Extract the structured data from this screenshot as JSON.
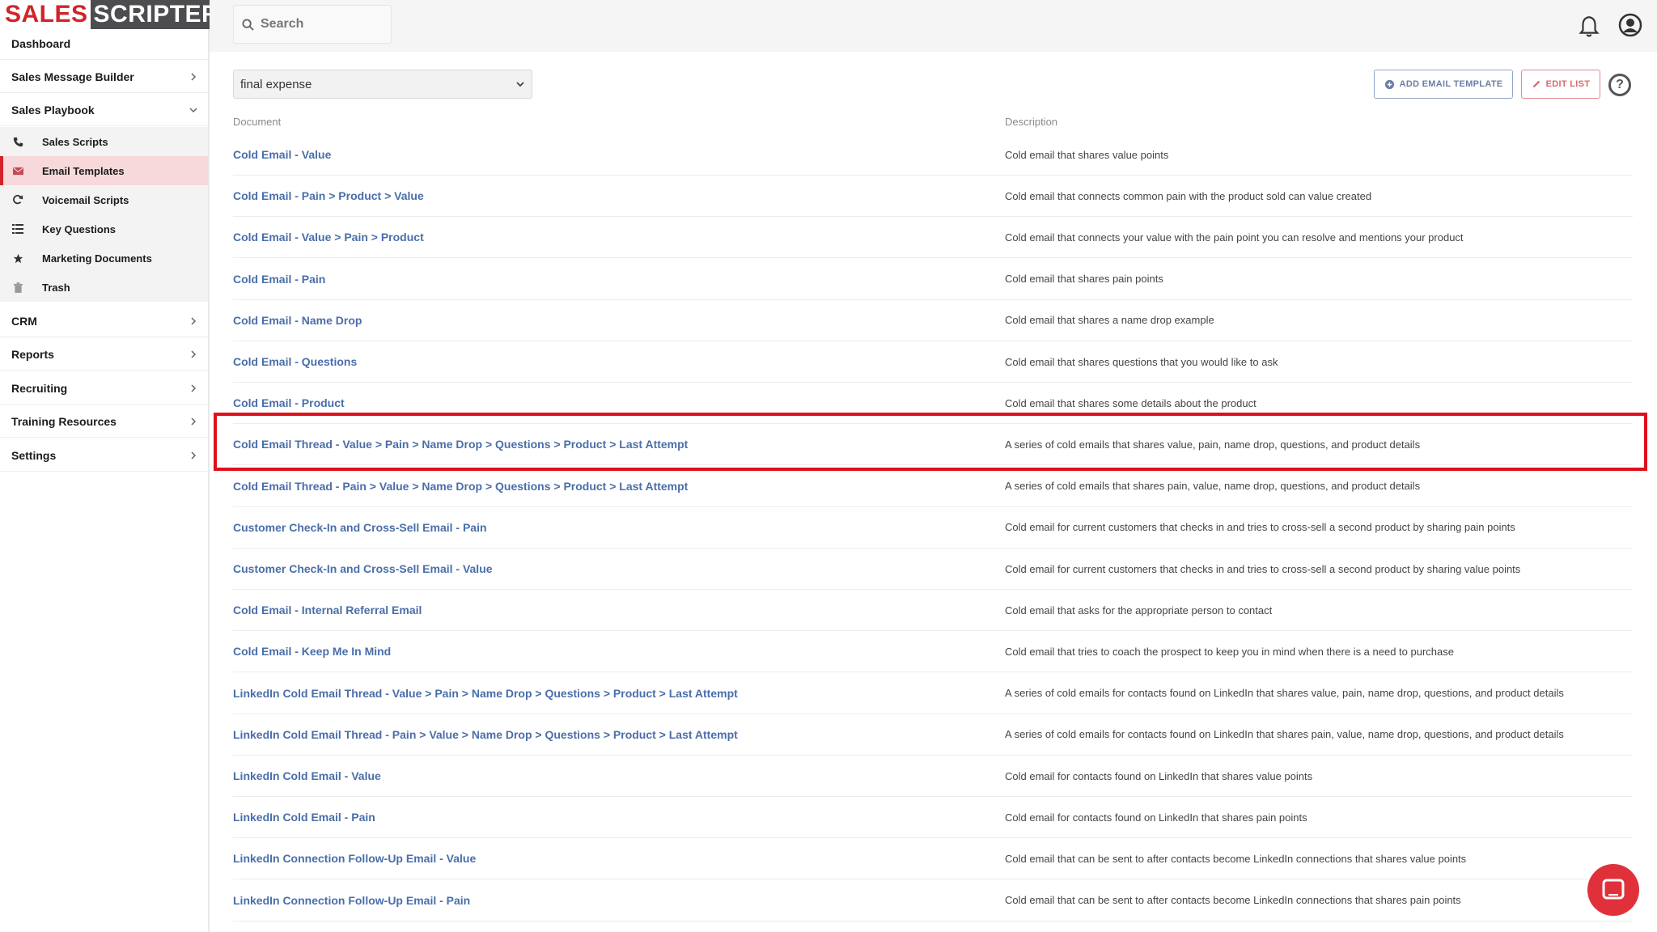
{
  "app": {
    "logo_left": "SALES",
    "logo_right": "SCRIPTER"
  },
  "search": {
    "placeholder": "Search"
  },
  "sidebar": {
    "dashboard": "Dashboard",
    "sales_message_builder": "Sales Message Builder",
    "sales_playbook": "Sales Playbook",
    "sub_items": [
      {
        "label": "Sales Scripts",
        "icon": "phone-icon"
      },
      {
        "label": "Email Templates",
        "icon": "email-icon"
      },
      {
        "label": "Voicemail Scripts",
        "icon": "voicemail-icon"
      },
      {
        "label": "Key Questions",
        "icon": "list-icon"
      },
      {
        "label": "Marketing Documents",
        "icon": "star-icon"
      },
      {
        "label": "Trash",
        "icon": "trash-icon"
      }
    ],
    "crm": "CRM",
    "reports": "Reports",
    "recruiting": "Recruiting",
    "training_resources": "Training Resources",
    "settings": "Settings"
  },
  "toolbar": {
    "filter_value": "final expense",
    "add_label": "ADD EMAIL TEMPLATE",
    "edit_label": "EDIT LIST",
    "help_label": "?"
  },
  "table": {
    "headers": {
      "document": "Document",
      "description": "Description"
    },
    "rows": [
      {
        "doc": "Cold Email - Value",
        "desc": "Cold email that shares value points"
      },
      {
        "doc": "Cold Email - Pain > Product > Value",
        "desc": "Cold email that connects common pain with the product sold can value created"
      },
      {
        "doc": "Cold Email - Value > Pain > Product",
        "desc": "Cold email that connects your value with the pain point you can resolve and mentions your product"
      },
      {
        "doc": "Cold Email - Pain",
        "desc": "Cold email that shares pain points"
      },
      {
        "doc": "Cold Email - Name Drop",
        "desc": "Cold email that shares a name drop example"
      },
      {
        "doc": "Cold Email - Questions",
        "desc": "Cold email that shares questions that you would like to ask"
      },
      {
        "doc": "Cold Email - Product",
        "desc": "Cold email that shares some details about the product"
      },
      {
        "doc": "Cold Email Thread - Value > Pain > Name Drop > Questions > Product > Last Attempt",
        "desc": "A series of cold emails that shares value, pain, name drop, questions, and product details"
      },
      {
        "doc": "Cold Email Thread - Pain > Value > Name Drop > Questions > Product > Last Attempt",
        "desc": "A series of cold emails that shares pain, value, name drop, questions, and product details"
      },
      {
        "doc": "Customer Check-In and Cross-Sell Email - Pain",
        "desc": "Cold email for current customers that checks in and tries to cross-sell a second product by sharing pain points"
      },
      {
        "doc": "Customer Check-In and Cross-Sell Email - Value",
        "desc": "Cold email for current customers that checks in and tries to cross-sell a second product by sharing value points"
      },
      {
        "doc": "Cold Email - Internal Referral Email",
        "desc": "Cold email that asks for the appropriate person to contact"
      },
      {
        "doc": "Cold Email - Keep Me In Mind",
        "desc": "Cold email that tries to coach the prospect to keep you in mind when there is a need to purchase"
      },
      {
        "doc": "LinkedIn Cold Email Thread - Value > Pain > Name Drop > Questions > Product > Last Attempt",
        "desc": "A series of cold emails for contacts found on LinkedIn that shares value, pain, name drop, questions, and product details"
      },
      {
        "doc": "LinkedIn Cold Email Thread - Pain > Value > Name Drop > Questions > Product > Last Attempt",
        "desc": "A series of cold emails for contacts found on LinkedIn that shares pain, value, name drop, questions, and product details"
      },
      {
        "doc": "LinkedIn Cold Email - Value",
        "desc": "Cold email for contacts found on LinkedIn that shares value points"
      },
      {
        "doc": "LinkedIn Cold Email - Pain",
        "desc": "Cold email for contacts found on LinkedIn that shares pain points"
      },
      {
        "doc": "LinkedIn Connection Follow-Up Email - Value",
        "desc": "Cold email that can be sent to after contacts become LinkedIn connections that shares value points"
      },
      {
        "doc": "LinkedIn Connection Follow-Up Email - Pain",
        "desc": "Cold email that can be sent to after contacts become LinkedIn connections that shares pain points"
      }
    ]
  },
  "colors": {
    "brand_red": "#d2232a",
    "link_blue": "#4a6ea9",
    "highlight_red": "#e0101a"
  }
}
